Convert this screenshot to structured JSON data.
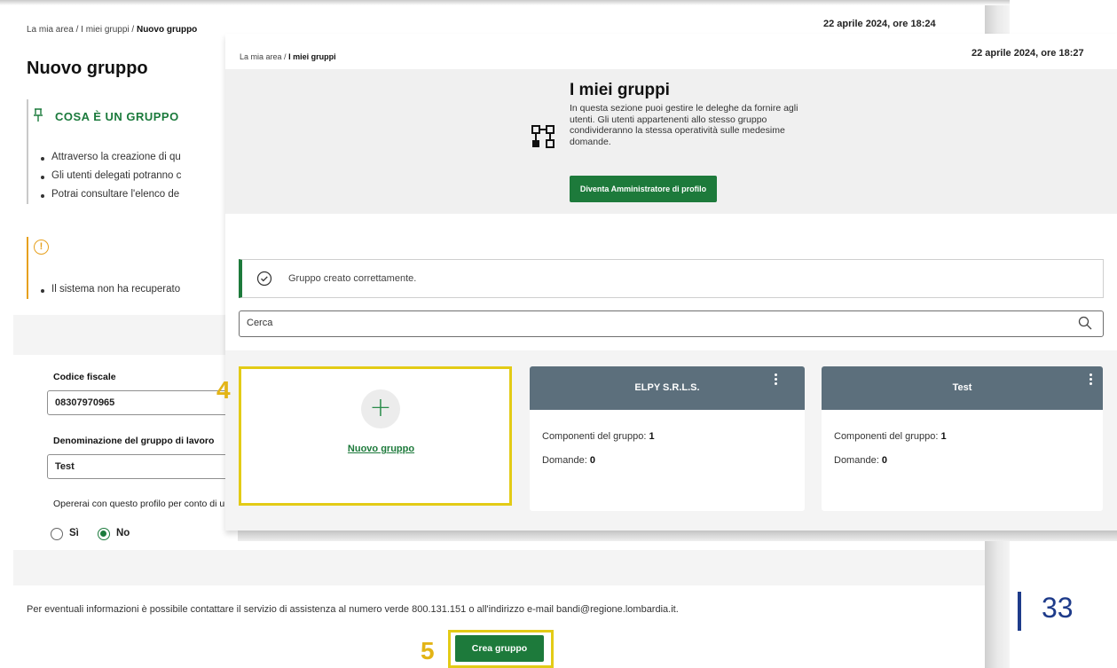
{
  "background_page": {
    "breadcrumb": [
      "La mia area",
      "I miei gruppi",
      "Nuovo gruppo"
    ],
    "timestamp": "22 aprile 2024, ore 18:24",
    "title": "Nuovo gruppo",
    "info_heading": "COSA È UN GRUPPO",
    "info_bullets": [
      "Attraverso la creazione di qu",
      "Gli utenti delegati potranno c",
      "Potrai consultare l'elenco de"
    ],
    "warning_bullet": "Il sistema non ha recuperato",
    "form": {
      "codice_fiscale_label": "Codice fiscale",
      "codice_fiscale_value": "08307970965",
      "denominazione_label": "Denominazione del gruppo di lavoro",
      "denominazione_value": "Test",
      "operate_question": "Opererai con questo profilo per conto di u",
      "options": [
        "Sì",
        "No"
      ],
      "selected": "No"
    },
    "footer_text": "Per eventuali informazioni è possibile contattare il servizio di assistenza al numero verde 800.131.151 o all'indirizzo e-mail bandi@regione.lombardia.it.",
    "crea_button": "Crea gruppo"
  },
  "overlay_page": {
    "breadcrumb": [
      "La mia area",
      "I miei gruppi"
    ],
    "timestamp": "22 aprile 2024, ore 18:27",
    "hero_title": "I miei gruppi",
    "hero_desc": "In questa sezione puoi gestire le deleghe da fornire agli utenti. Gli utenti appartenenti allo stesso gruppo condivideranno la stessa operatività sulle medesime domande.",
    "admin_button": "Diventa Amministratore di profilo",
    "success_message": "Gruppo creato correttamente.",
    "search_placeholder": "Cerca",
    "new_group_label": "Nuovo gruppo",
    "groups": [
      {
        "name": "ELPY S.R.L.S.",
        "components_label": "Componenti del gruppo:",
        "components": "1",
        "domande_label": "Domande:",
        "domande": "0"
      },
      {
        "name": "Test",
        "components_label": "Componenti del gruppo:",
        "components": "1",
        "domande_label": "Domande:",
        "domande": "0"
      }
    ]
  },
  "callouts": [
    "4",
    "5"
  ],
  "page_number": "33",
  "colors": {
    "primary_green": "#1d7a3b",
    "highlight_yellow": "#e3cb16",
    "card_header": "#5c6f7c",
    "warning": "#e6a01e",
    "page_num_blue": "#1e3b8a"
  }
}
